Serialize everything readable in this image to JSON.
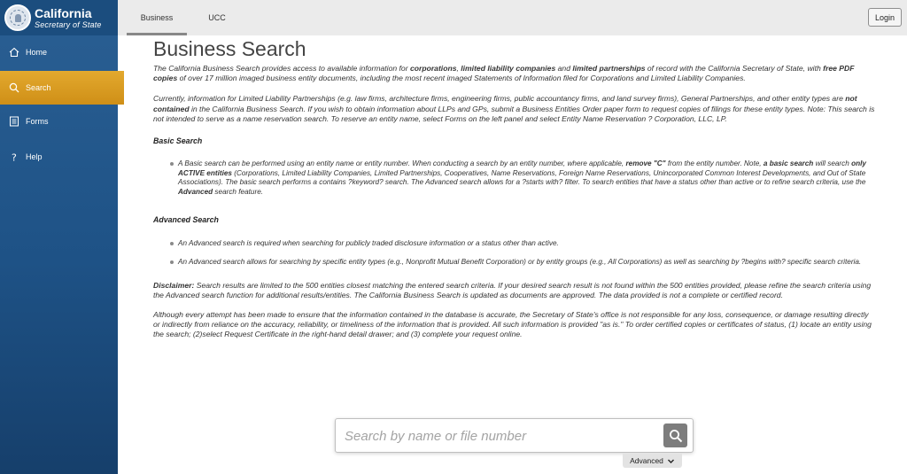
{
  "brand": {
    "title": "California",
    "subtitle": "Secretary of State"
  },
  "sidebar": {
    "items": [
      {
        "label": "Home",
        "icon": "home-icon"
      },
      {
        "label": "Search",
        "icon": "search-icon",
        "active": true
      },
      {
        "label": "Forms",
        "icon": "forms-icon"
      },
      {
        "label": "Help",
        "icon": "help-icon"
      }
    ]
  },
  "header": {
    "tabs": [
      {
        "label": "Business",
        "active": true
      },
      {
        "label": "UCC"
      }
    ],
    "login_label": "Login"
  },
  "colors": {
    "sidebar": "#1e5286",
    "active": "#d9961c",
    "topbar": "#ebebeb"
  },
  "main": {
    "title": "Business Search",
    "intro": {
      "t1": "The California Business Search provides access to available information for ",
      "b1": "corporations",
      "t2": ", ",
      "b2": "limited liability companies",
      "t3": " and ",
      "b3": "limited partnerships",
      "t4": " of record with the California Secretary of State, with ",
      "b4": "free PDF copies",
      "t5": " of over 17 million imaged business entity documents, including the most recent imaged Statements of Information filed for Corporations and Limited Liability Companies."
    },
    "currently": {
      "t1": "Currently, information for Limited Liability Partnerships (e.g. law firms, architecture firms, engineering firms, public accountancy firms, and land survey firms), General Partnerships, and other entity types are ",
      "b1": "not contained",
      "t2": " in the California Business Search. If you wish to obtain information about LLPs and GPs, submit a Business Entities Order paper form to request copies of filings for these entity types. Note: This search is not intended to serve as a name reservation search. To reserve an entity name, select Forms on the left panel and select Entity Name Reservation ? Corporation, LLC, LP."
    },
    "basic": {
      "heading": "Basic Search",
      "t1": "A Basic search can be performed using an entity name or entity number. When conducting a search by an entity number, where applicable, ",
      "b1": "remove \"C\"",
      "t2": " from the entity number. Note, ",
      "b2": "a basic search",
      "t3": " will search ",
      "b3": "only ACTIVE entities",
      "t4": " (Corporations, Limited Liability Companies, Limited Partnerships, Cooperatives, Name Reservations, Foreign Name Reservations, Unincorporated Common Interest Developments, and Out of State Associations). The basic search performs a contains ?keyword? search. The Advanced search allows for a ?starts with? filter. To search entities that have a status other than active or to refine search criteria, use the ",
      "b4": "Advanced",
      "t5": " search feature."
    },
    "advanced": {
      "heading": "Advanced Search",
      "items": [
        "An Advanced search is required when searching for publicly traded disclosure information or a status other than active.",
        "An Advanced search allows for searching by specific entity types (e.g., Nonprofit Mutual Benefit Corporation) or by entity groups (e.g., All Corporations) as well as searching by ?begins with? specific search criteria."
      ]
    },
    "disclaimer": {
      "label": "Disclaimer:",
      "text": " Search results are limited to the 500 entities closest matching the entered search criteria. If your desired search result is not found within the 500 entities provided, please refine the search criteria using the Advanced search function for additional results/entities. The California Business Search is updated as documents are approved. The data provided is not a complete or certified record."
    },
    "liability": "Although every attempt has been made to ensure that the information contained in the database is accurate, the Secretary of State's office is not responsible for any loss, consequence, or damage resulting directly or indirectly from reliance on the accuracy, reliability, or timeliness of the information that is provided. All such information is provided \"as is.\" To order certified copies or certificates of status, (1) locate an entity using the search; (2)select Request Certificate in the right-hand detail drawer; and (3) complete your request online."
  },
  "search": {
    "placeholder": "Search by name or file number",
    "value": "",
    "advanced_label": "Advanced"
  }
}
